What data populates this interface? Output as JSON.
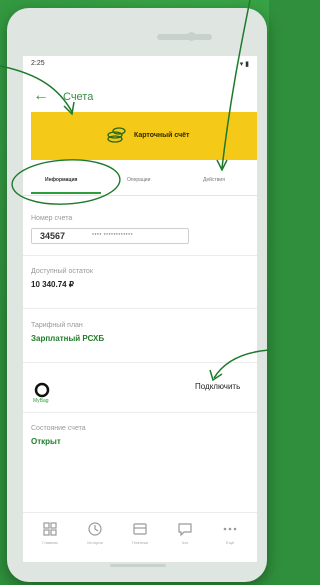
{
  "status_bar": {
    "time": "2:25"
  },
  "header": {
    "title": "Счета"
  },
  "banner": {
    "title": "Карточный счёт"
  },
  "tabs": [
    {
      "label": "Информация",
      "active": true
    },
    {
      "label": "Операции",
      "active": false
    },
    {
      "label": "Действия",
      "active": false
    }
  ],
  "account": {
    "number_label": "Номер счета",
    "number_visible": "34567",
    "number_masked": "**** ************"
  },
  "balance": {
    "label": "Доступный остаток",
    "value": "10 340.74 ₽"
  },
  "tariff": {
    "label": "Тарифный план",
    "value": "Зарплатный РСХБ"
  },
  "mybag": {
    "logo_text": "MyBag",
    "action_label": "Подключить"
  },
  "state": {
    "label": "Состояние счета",
    "value": "Открыт"
  },
  "bottom_nav": [
    {
      "label": "Главная",
      "icon": "grid-icon"
    },
    {
      "label": "История",
      "icon": "clock-icon"
    },
    {
      "label": "Платежи",
      "icon": "card-icon"
    },
    {
      "label": "Чат",
      "icon": "chat-icon"
    },
    {
      "label": "Ещё",
      "icon": "more-icon"
    }
  ],
  "colors": {
    "accent": "#2e9e3a",
    "banner": "#f5c917",
    "background": "#2f8f3c"
  }
}
